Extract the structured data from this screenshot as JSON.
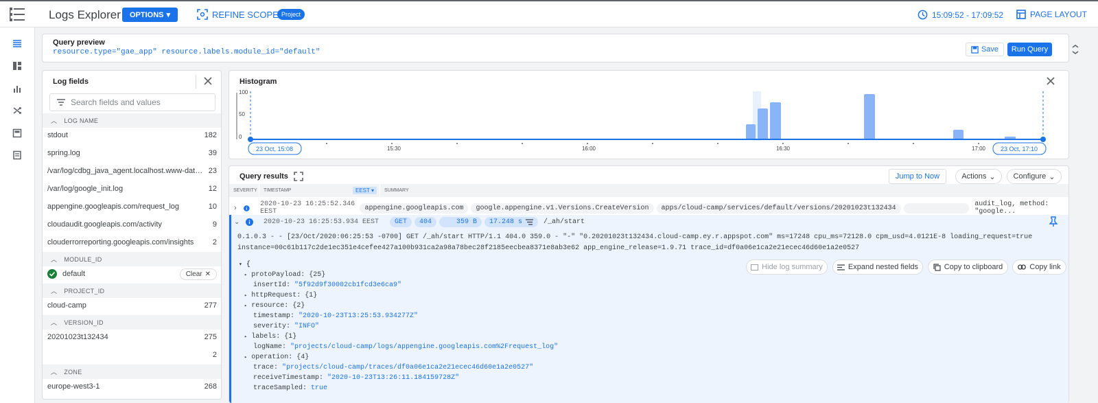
{
  "app": {
    "title": "Logs Explorer",
    "options_label": "OPTIONS",
    "refine_scope_label": "REFINE SCOPE",
    "scope_badge": "Project",
    "time_range": "15:09:52 - 17:09:52",
    "page_layout_label": "PAGE LAYOUT",
    "accent": "#1a73e8"
  },
  "query_preview": {
    "title": "Query preview",
    "query": "resource.type=\"gae_app\" resource.labels.module_id=\"default\"",
    "save_label": "Save",
    "run_label": "Run Query"
  },
  "log_fields": {
    "title": "Log fields",
    "search_placeholder": "Search fields and values",
    "sections": {
      "log_name": "LOG NAME",
      "module_id": "MODULE_ID",
      "project_id": "PROJECT_ID",
      "version_id": "VERSION_ID",
      "zone": "ZONE"
    },
    "log_names": [
      {
        "name": "stdout",
        "count": "182"
      },
      {
        "name": "spring.log",
        "count": "39"
      },
      {
        "name": "/var/log/cdbg_java_agent.localhost.www-data.l...",
        "count": "23"
      },
      {
        "name": "/var/log/google_init.log",
        "count": "12"
      },
      {
        "name": "appengine.googleapis.com/request_log",
        "count": "10"
      },
      {
        "name": "cloudaudit.googleapis.com/activity",
        "count": "9"
      },
      {
        "name": "clouderrorreporting.googleapis.com/insights",
        "count": "2"
      }
    ],
    "module": {
      "name": "default",
      "clear_label": "Clear"
    },
    "project": {
      "name": "cloud-camp",
      "count": "277"
    },
    "versions": [
      {
        "name": "20201023t132434",
        "count": "275"
      },
      {
        "name": "",
        "count": "2"
      }
    ],
    "zone": {
      "name": "europe-west3-1",
      "count": "268"
    }
  },
  "histogram": {
    "title": "Histogram",
    "y_ticks": [
      "100",
      "50",
      "0"
    ],
    "x_ticks": [
      "15:30",
      "16:00",
      "16:30",
      "17:00"
    ],
    "start_label": "23 Oct, 15:08",
    "end_label": "23 Oct, 17:10",
    "bar_color": "#8ab4f8"
  },
  "results": {
    "title": "Query results",
    "jump_label": "Jump to Now",
    "actions_label": "Actions",
    "configure_label": "Configure",
    "columns": {
      "severity": "SEVERITY",
      "timestamp": "TIMESTAMP",
      "tz": "EEST",
      "summary": "SUMMARY"
    },
    "row1": {
      "timestamp": "2020-10-23 16:25:52.346 EEST",
      "chips": [
        "appengine.googleapis.com",
        "google.appengine.v1.Versions.CreateVersion",
        "apps/cloud-camp/services/default/versions/20201023t132434"
      ],
      "tail": "audit_log, method: \"google..."
    },
    "row2": {
      "timestamp": "2020-10-23 16:25:53.934 EEST",
      "method": "GET",
      "status": "404",
      "size": "359 B",
      "latency": "17.248 s",
      "path": "/_ah/start"
    },
    "raw_line1": "0.1.0.3 - - [23/Oct/2020:06:25:53 -0700] GET /_ah/start HTTP/1.1 404.0 359.0 - \"-\" \"0.20201023t132434.cloud-camp.ey.r.appspot.com\" ms=17248 cpu_ms=72128.0 cpm_usd=4.0121E-8 loading_request=true",
    "raw_line2": "instance=00c61b117c2de1ec351e4cefee427a100b931ca2a98a78bec28f2185eecbea8371e8ab3e62 app_engine_release=1.9.71 trace_id=df0a06e1ca2e21ecec46d60e1a2e0527",
    "buttons": {
      "hide_summary": "Hide log summary",
      "expand_nested": "Expand nested fields",
      "copy_clipboard": "Copy to clipboard",
      "copy_link": "Copy link"
    },
    "json": {
      "open_brace": "{",
      "proto_payload": "protoPayload: {25}",
      "insert_id_key": "insertId:",
      "insert_id_val": "\"5f92d9f30002cb1fcd3e6ca9\"",
      "http_request": "httpRequest: {1}",
      "resource": "resource: {2}",
      "timestamp_key": "timestamp:",
      "timestamp_val": "\"2020-10-23T13:25:53.934277Z\"",
      "severity_key": "severity:",
      "severity_val": "\"INFO\"",
      "labels": "labels: {1}",
      "logname_key": "logName:",
      "logname_val": "\"projects/cloud-camp/logs/appengine.googleapis.com%2Frequest_log\"",
      "operation": "operation: {4}",
      "trace_key": "trace:",
      "trace_val": "\"projects/cloud-camp/traces/df0a06e1ca2e21ecec46d60e1a2e0527\"",
      "receive_key": "receiveTimestamp:",
      "receive_val": "\"2020-10-23T13:26:11.184159728Z\"",
      "sampled_key": "traceSampled:",
      "sampled_val": "true"
    }
  }
}
